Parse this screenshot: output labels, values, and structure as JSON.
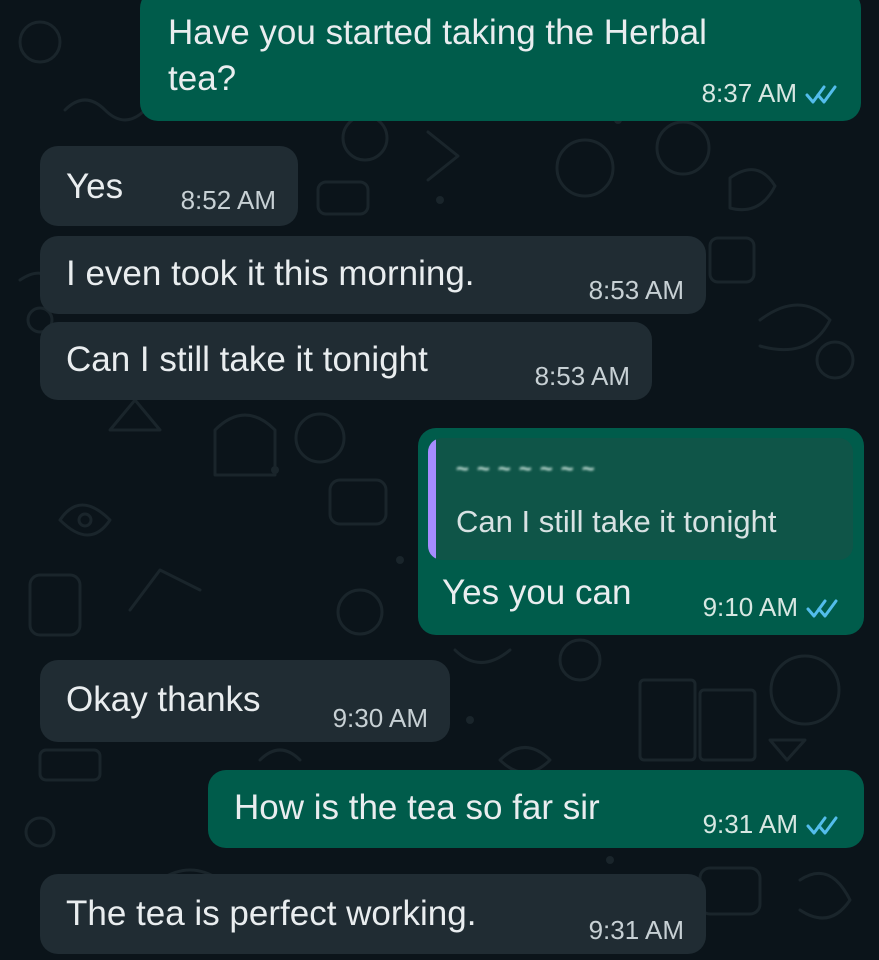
{
  "messages": [
    {
      "direction": "outgoing",
      "text": "Have you started taking the Herbal tea?",
      "line_1": "Have you started taking the Herbal",
      "line_2": "tea?",
      "time": "8:37 AM",
      "status": "read"
    },
    {
      "direction": "incoming",
      "text": "Yes",
      "time": "8:52 AM"
    },
    {
      "direction": "incoming",
      "text": "I even took it this morning.",
      "time": "8:53 AM"
    },
    {
      "direction": "incoming",
      "text": "Can I still take it tonight",
      "time": "8:53 AM"
    },
    {
      "direction": "outgoing",
      "reply": {
        "sender": "~ ~ ~ ~ ~ ~ ~",
        "text": "Can I still take it tonight"
      },
      "text": "Yes you can",
      "time": "9:10 AM",
      "status": "read"
    },
    {
      "direction": "incoming",
      "text": "Okay thanks",
      "time": "9:30 AM"
    },
    {
      "direction": "outgoing",
      "text": "How is the tea so far sir",
      "time": "9:31 AM",
      "status": "read"
    },
    {
      "direction": "incoming",
      "text": "The tea is perfect working.",
      "time": "9:31 AM"
    }
  ],
  "icons": {
    "read_receipt": "double-check-icon",
    "wallpaper": "doodle-pattern"
  },
  "colors": {
    "background": "#0b141a",
    "incoming_bubble": "#202c33",
    "outgoing_bubble": "#005c4b",
    "read_tick": "#53bdeb",
    "reply_bar": "#a68cff"
  }
}
